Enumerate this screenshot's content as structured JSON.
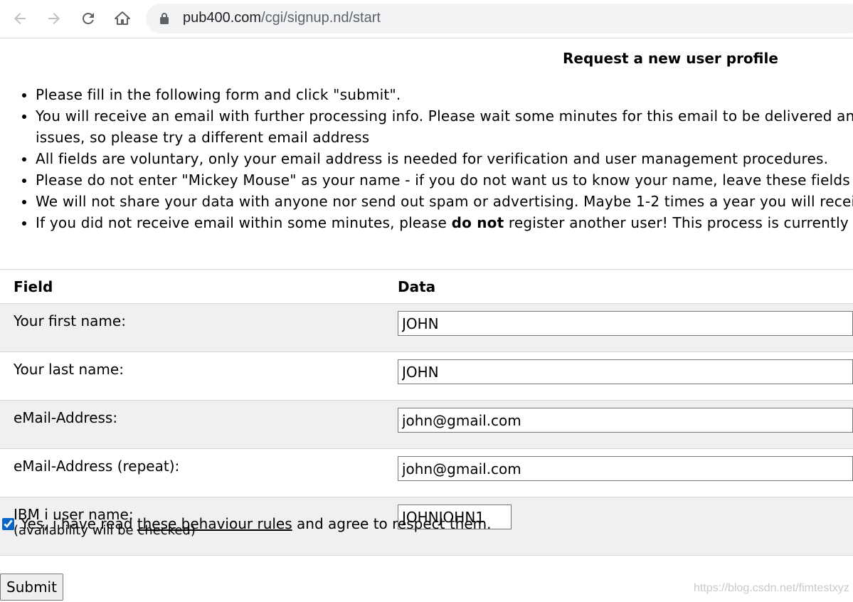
{
  "browser": {
    "url_host": "pub400.com",
    "url_path": "/cgi/signup.nd/start"
  },
  "page": {
    "title": "Request a new user profile",
    "bullets": [
      "Please fill in the following form and click \"submit\".",
      "You will receive an email with further processing info. Please wait some minutes for this email to be delivered an",
      "issues, so please try a different email address",
      "All fields are voluntary, only your email address is needed for verification and user management procedures.",
      "Please do not enter \"Mickey Mouse\" as your name - if you do not want us to know your name, leave these fields",
      "We will not share your data with anyone nor send out spam or advertising. Maybe 1-2 times a year you will recei",
      "If you did not receive email within some minutes, please",
      "do not",
      "register another user! This process is currently"
    ]
  },
  "form": {
    "header_field": "Field",
    "header_data": "Data",
    "rows": [
      {
        "label": "Your first name:",
        "value": "JOHN"
      },
      {
        "label": "Your last name:",
        "value": "JOHN"
      },
      {
        "label": "eMail-Address:",
        "value": "john@gmail.com"
      },
      {
        "label": "eMail-Address (repeat):",
        "value": "john@gmail.com"
      },
      {
        "label": "IBM i user name:",
        "sublabel": "(availability will be checked)",
        "value": "JOHNJOHN1"
      }
    ],
    "agree_prefix": "Yes, i have read",
    "agree_link": "these behaviour rules",
    "agree_suffix": "and agree to respect them.",
    "agree_checked": true,
    "submit_label": "Submit"
  },
  "watermark": "https://blog.csdn.net/fimtestxyz"
}
